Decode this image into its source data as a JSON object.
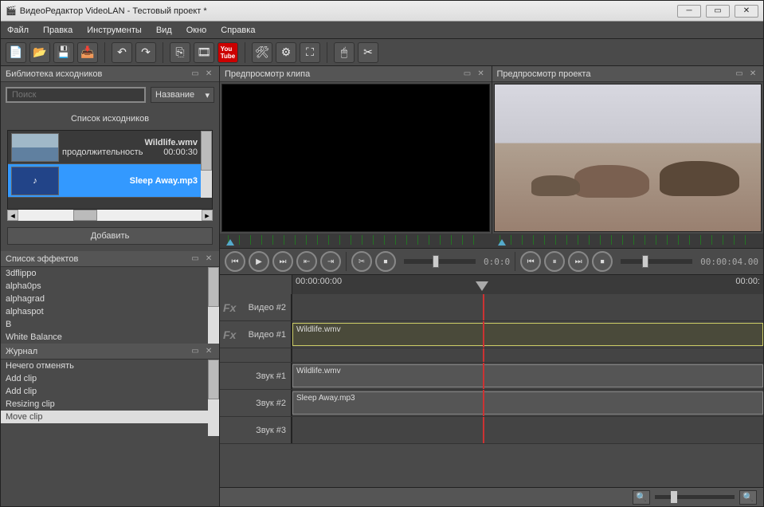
{
  "titlebar": {
    "title": "ВидеоРедактор VideoLAN - Тестовый проект *"
  },
  "menu": {
    "file": "Файл",
    "edit": "Правка",
    "tools": "Инструменты",
    "view": "Вид",
    "window": "Окно",
    "help": "Справка"
  },
  "panels": {
    "library": "Библиотека исходников",
    "clip_preview": "Предпросмотр клипа",
    "project_preview": "Предпросмотр проекта",
    "effects": "Список эффектов",
    "journal": "Журнал"
  },
  "library": {
    "search_placeholder": "Поиск",
    "sort_label": "Название",
    "list_label": "Список исходников",
    "add_button": "Добавить",
    "items": [
      {
        "name": "Wildlife.wmv",
        "duration_label": "продолжительность",
        "duration": "00:00:30"
      },
      {
        "name": "Sleep Away.mp3"
      }
    ]
  },
  "effects": {
    "items": [
      "3dflippo",
      "alpha0ps",
      "alphagrad",
      "alphaspot",
      "B",
      "White Balance"
    ]
  },
  "journal": {
    "items": [
      "Нечего отменять",
      "Add clip",
      "Add clip",
      "Resizing clip",
      "Move clip"
    ]
  },
  "transport": {
    "timecode_left": "0:0:0",
    "timecode_right": "00:00:04.00"
  },
  "timeline": {
    "start_time": "00:00:00:00",
    "end_time": "00:00:",
    "tracks": {
      "video2": "Видео #2",
      "video1": "Видео #1",
      "audio1": "Звук #1",
      "audio2": "Звук #2",
      "audio3": "Звук #3"
    },
    "fx_label": "Fx",
    "clips": {
      "video1": "Wildlife.wmv",
      "audio1": "Wildlife.wmv",
      "audio2": "Sleep Away.mp3"
    }
  }
}
